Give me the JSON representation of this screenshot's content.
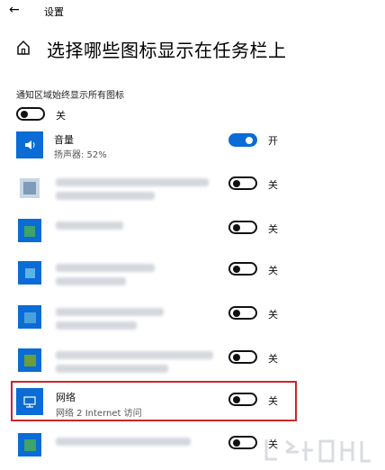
{
  "header": {
    "back_icon": "back-arrow-icon",
    "app_title": "设置"
  },
  "page": {
    "title": "选择哪些图标显示在任务栏上",
    "home_icon": "home-icon"
  },
  "always_show": {
    "label": "通知区域始终显示所有图标",
    "state": "关"
  },
  "items": [
    {
      "name": "音量",
      "sub": "扬声器: 52%",
      "state": "开",
      "icon": "speaker-icon"
    },
    {
      "name": "",
      "sub": "",
      "state": "关",
      "icon": "app-icon"
    },
    {
      "name": "",
      "sub": "",
      "state": "关",
      "icon": "app-icon"
    },
    {
      "name": "",
      "sub": "",
      "state": "关",
      "icon": "app-icon"
    },
    {
      "name": "",
      "sub": "",
      "state": "关",
      "icon": "app-icon"
    },
    {
      "name": "",
      "sub": "",
      "state": "关",
      "icon": "app-icon"
    },
    {
      "name": "网络",
      "sub": "网络 2 Internet 访问",
      "state": "关",
      "icon": "network-icon"
    },
    {
      "name": "",
      "sub": "",
      "state": "关",
      "icon": "app-icon"
    }
  ],
  "colors": {
    "accent": "#0a6cd4",
    "highlight": "#c8272d"
  }
}
